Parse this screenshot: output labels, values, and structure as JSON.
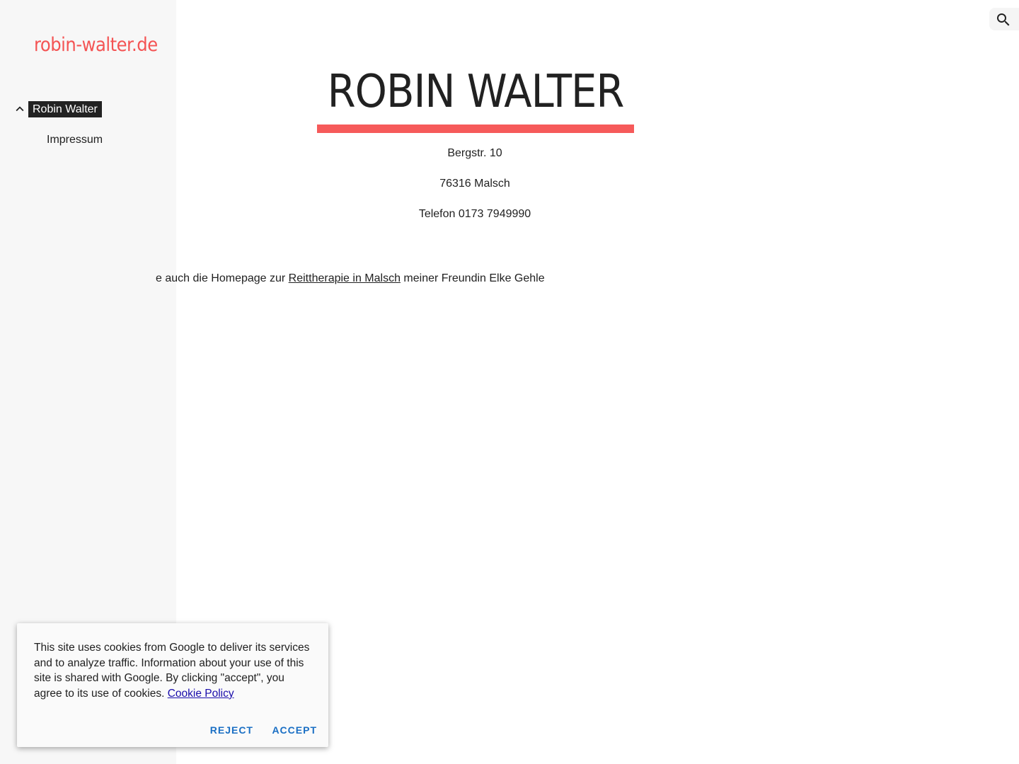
{
  "sidebar": {
    "site_title": "robin-walter.de",
    "nav_active_label": "Robin Walter",
    "nav_sub_label": "Impressum"
  },
  "header": {
    "search_icon": "search-icon"
  },
  "main": {
    "title": "ROBIN WALTER",
    "address_line1": "Bergstr. 10",
    "address_line2": "76316 Malsch",
    "phone": "Telefon 0173 7949990",
    "note_prefix": "e auch die Homepage zur ",
    "note_link": "Reittherapie in Malsch",
    "note_suffix": " meiner Freundin Elke Gehle"
  },
  "cookie_banner": {
    "text": "This site uses cookies from Google to deliver its services and to analyze traffic. Information about your use of this site is shared with Google. By clicking \"accept\", you agree to its use of cookies.",
    "policy_link": "Cookie Policy",
    "reject_label": "REJECT",
    "accept_label": "ACCEPT"
  },
  "colors": {
    "accent": "#f45454",
    "sidebar_bg": "#f7f7f7",
    "button_blue": "#1a6fc4"
  }
}
